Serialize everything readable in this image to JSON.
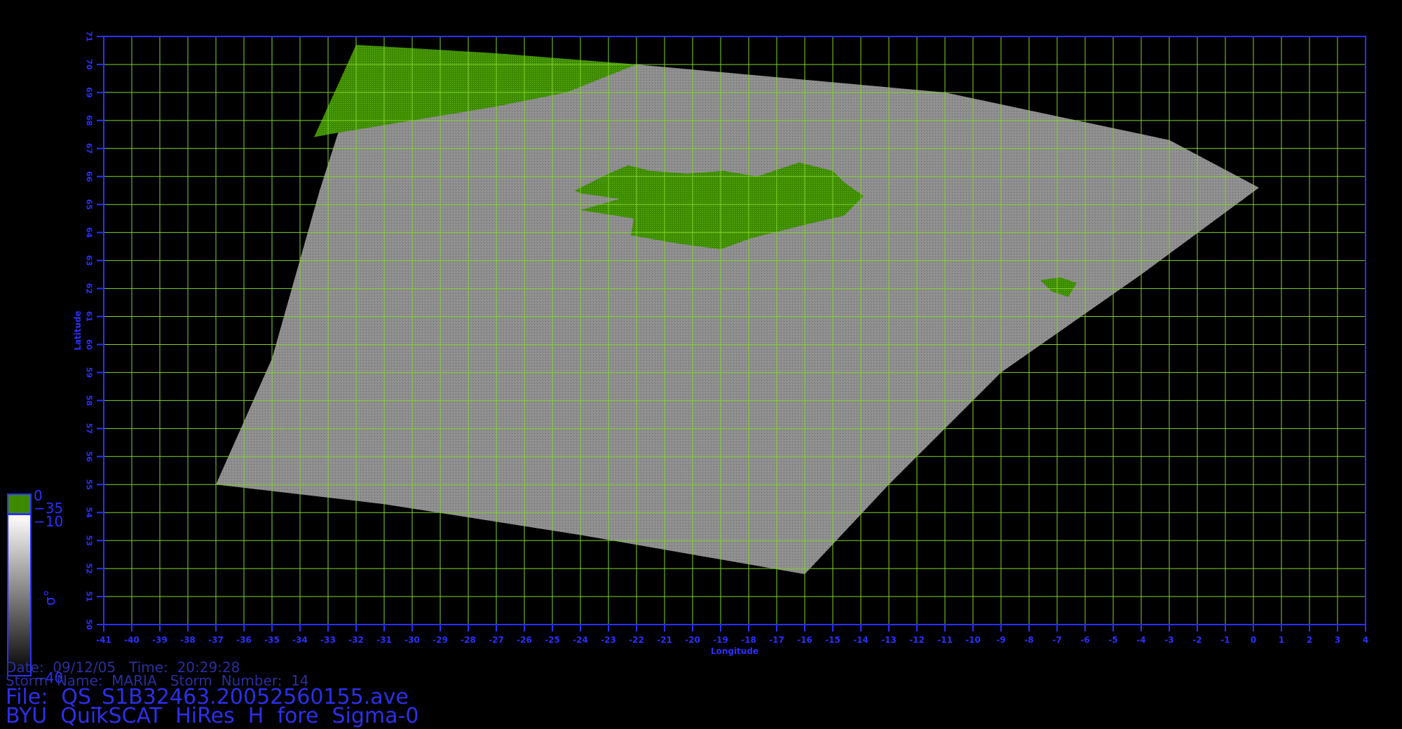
{
  "colors": {
    "axis": "#2c30ff",
    "grid": "#7fd32a",
    "land": "#3d8a00",
    "ice": "#5a9e10",
    "background": "#000000"
  },
  "axes": {
    "x_title": "Longitude",
    "y_title": "Latitude",
    "lon_range": [
      -41,
      4
    ],
    "lat_range": [
      50,
      71
    ],
    "lon_ticks": [
      "-41",
      "-40",
      "-39",
      "-38",
      "-37",
      "-36",
      "-35",
      "-34",
      "-33",
      "-32",
      "-31",
      "-30",
      "-29",
      "-28",
      "-27",
      "-26",
      "-25",
      "-24",
      "-23",
      "-22",
      "-21",
      "-20",
      "-19",
      "-18",
      "-17",
      "-16",
      "-15",
      "-14",
      "-13",
      "-12",
      "-11",
      "-10",
      "-9",
      "-8",
      "-7",
      "-6",
      "-5",
      "-4",
      "-3",
      "-2",
      "-1",
      "0",
      "1",
      "2",
      "3",
      "4"
    ],
    "lat_ticks": [
      "50",
      "51",
      "52",
      "53",
      "54",
      "55",
      "56",
      "57",
      "58",
      "59",
      "60",
      "61",
      "62",
      "63",
      "64",
      "65",
      "66",
      "67",
      "68",
      "69",
      "70",
      "71"
    ]
  },
  "swath": {
    "corners_lonlat": [
      [
        -32,
        70.7
      ],
      [
        -22,
        70.0
      ],
      [
        -11,
        69.0
      ],
      [
        -3,
        67.3
      ],
      [
        0.2,
        65.6
      ],
      [
        -4,
        62.5
      ],
      [
        -9,
        59.0
      ],
      [
        -13,
        55.0
      ],
      [
        -16,
        51.8
      ],
      [
        -24,
        53.2
      ],
      [
        -31,
        54.3
      ],
      [
        -37,
        55.0
      ],
      [
        -35,
        59.5
      ],
      [
        -33.3,
        65.5
      ],
      [
        -32.5,
        68.0
      ]
    ]
  },
  "landmasses": [
    {
      "name": "Iceland",
      "outline_lonlat": [
        [
          -24.2,
          65.5
        ],
        [
          -23.0,
          66.1
        ],
        [
          -22.3,
          66.4
        ],
        [
          -21.5,
          66.2
        ],
        [
          -20.2,
          66.1
        ],
        [
          -18.9,
          66.2
        ],
        [
          -17.7,
          66.0
        ],
        [
          -16.2,
          66.5
        ],
        [
          -15.0,
          66.2
        ],
        [
          -14.6,
          65.8
        ],
        [
          -13.9,
          65.3
        ],
        [
          -14.6,
          64.6
        ],
        [
          -15.9,
          64.3
        ],
        [
          -17.9,
          63.8
        ],
        [
          -19.0,
          63.4
        ],
        [
          -20.5,
          63.6
        ],
        [
          -22.2,
          63.9
        ],
        [
          -22.1,
          64.5
        ],
        [
          -24.0,
          64.8
        ],
        [
          -22.6,
          65.2
        ],
        [
          -24.0,
          65.4
        ]
      ]
    },
    {
      "name": "Faroe Islands",
      "outline_lonlat": [
        [
          -7.6,
          62.3
        ],
        [
          -6.9,
          62.4
        ],
        [
          -6.3,
          62.2
        ],
        [
          -6.6,
          61.7
        ],
        [
          -7.2,
          61.9
        ]
      ]
    },
    {
      "name": "Greenland ice edge",
      "outline_lonlat": [
        [
          -32.0,
          70.7
        ],
        [
          -27.0,
          70.4
        ],
        [
          -22.0,
          70.0
        ],
        [
          -24.5,
          69.0
        ],
        [
          -27.0,
          68.5
        ],
        [
          -30.0,
          68.0
        ],
        [
          -33.0,
          67.5
        ],
        [
          -33.5,
          67.4
        ]
      ]
    }
  ],
  "colorbar": {
    "symbol": "σ°",
    "labels": {
      "top": "0",
      "upper_mid": "−35",
      "lower_mid": "−10",
      "bottom": "−40"
    }
  },
  "info": {
    "date_line": "Date:  09/12/05   Time:  20:29:28",
    "storm_line": "Storm  Name:  MARIA   Storm  Number:  14",
    "file_line": "File:  QS_S1B32463.20052560155.ave",
    "product_line": "BYU  QuikSCAT  HiRes  H  fore  Sigma-0"
  }
}
